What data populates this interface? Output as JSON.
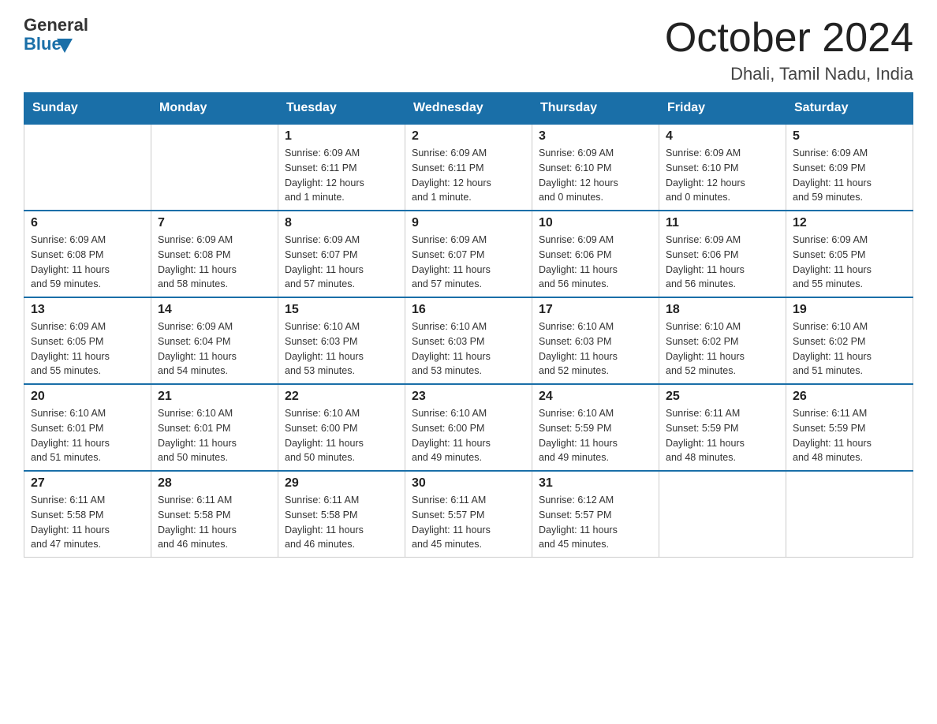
{
  "header": {
    "logo_general": "General",
    "logo_blue": "Blue",
    "title": "October 2024",
    "subtitle": "Dhali, Tamil Nadu, India"
  },
  "days_of_week": [
    "Sunday",
    "Monday",
    "Tuesday",
    "Wednesday",
    "Thursday",
    "Friday",
    "Saturday"
  ],
  "weeks": [
    [
      {
        "day": "",
        "info": ""
      },
      {
        "day": "",
        "info": ""
      },
      {
        "day": "1",
        "info": "Sunrise: 6:09 AM\nSunset: 6:11 PM\nDaylight: 12 hours\nand 1 minute."
      },
      {
        "day": "2",
        "info": "Sunrise: 6:09 AM\nSunset: 6:11 PM\nDaylight: 12 hours\nand 1 minute."
      },
      {
        "day": "3",
        "info": "Sunrise: 6:09 AM\nSunset: 6:10 PM\nDaylight: 12 hours\nand 0 minutes."
      },
      {
        "day": "4",
        "info": "Sunrise: 6:09 AM\nSunset: 6:10 PM\nDaylight: 12 hours\nand 0 minutes."
      },
      {
        "day": "5",
        "info": "Sunrise: 6:09 AM\nSunset: 6:09 PM\nDaylight: 11 hours\nand 59 minutes."
      }
    ],
    [
      {
        "day": "6",
        "info": "Sunrise: 6:09 AM\nSunset: 6:08 PM\nDaylight: 11 hours\nand 59 minutes."
      },
      {
        "day": "7",
        "info": "Sunrise: 6:09 AM\nSunset: 6:08 PM\nDaylight: 11 hours\nand 58 minutes."
      },
      {
        "day": "8",
        "info": "Sunrise: 6:09 AM\nSunset: 6:07 PM\nDaylight: 11 hours\nand 57 minutes."
      },
      {
        "day": "9",
        "info": "Sunrise: 6:09 AM\nSunset: 6:07 PM\nDaylight: 11 hours\nand 57 minutes."
      },
      {
        "day": "10",
        "info": "Sunrise: 6:09 AM\nSunset: 6:06 PM\nDaylight: 11 hours\nand 56 minutes."
      },
      {
        "day": "11",
        "info": "Sunrise: 6:09 AM\nSunset: 6:06 PM\nDaylight: 11 hours\nand 56 minutes."
      },
      {
        "day": "12",
        "info": "Sunrise: 6:09 AM\nSunset: 6:05 PM\nDaylight: 11 hours\nand 55 minutes."
      }
    ],
    [
      {
        "day": "13",
        "info": "Sunrise: 6:09 AM\nSunset: 6:05 PM\nDaylight: 11 hours\nand 55 minutes."
      },
      {
        "day": "14",
        "info": "Sunrise: 6:09 AM\nSunset: 6:04 PM\nDaylight: 11 hours\nand 54 minutes."
      },
      {
        "day": "15",
        "info": "Sunrise: 6:10 AM\nSunset: 6:03 PM\nDaylight: 11 hours\nand 53 minutes."
      },
      {
        "day": "16",
        "info": "Sunrise: 6:10 AM\nSunset: 6:03 PM\nDaylight: 11 hours\nand 53 minutes."
      },
      {
        "day": "17",
        "info": "Sunrise: 6:10 AM\nSunset: 6:03 PM\nDaylight: 11 hours\nand 52 minutes."
      },
      {
        "day": "18",
        "info": "Sunrise: 6:10 AM\nSunset: 6:02 PM\nDaylight: 11 hours\nand 52 minutes."
      },
      {
        "day": "19",
        "info": "Sunrise: 6:10 AM\nSunset: 6:02 PM\nDaylight: 11 hours\nand 51 minutes."
      }
    ],
    [
      {
        "day": "20",
        "info": "Sunrise: 6:10 AM\nSunset: 6:01 PM\nDaylight: 11 hours\nand 51 minutes."
      },
      {
        "day": "21",
        "info": "Sunrise: 6:10 AM\nSunset: 6:01 PM\nDaylight: 11 hours\nand 50 minutes."
      },
      {
        "day": "22",
        "info": "Sunrise: 6:10 AM\nSunset: 6:00 PM\nDaylight: 11 hours\nand 50 minutes."
      },
      {
        "day": "23",
        "info": "Sunrise: 6:10 AM\nSunset: 6:00 PM\nDaylight: 11 hours\nand 49 minutes."
      },
      {
        "day": "24",
        "info": "Sunrise: 6:10 AM\nSunset: 5:59 PM\nDaylight: 11 hours\nand 49 minutes."
      },
      {
        "day": "25",
        "info": "Sunrise: 6:11 AM\nSunset: 5:59 PM\nDaylight: 11 hours\nand 48 minutes."
      },
      {
        "day": "26",
        "info": "Sunrise: 6:11 AM\nSunset: 5:59 PM\nDaylight: 11 hours\nand 48 minutes."
      }
    ],
    [
      {
        "day": "27",
        "info": "Sunrise: 6:11 AM\nSunset: 5:58 PM\nDaylight: 11 hours\nand 47 minutes."
      },
      {
        "day": "28",
        "info": "Sunrise: 6:11 AM\nSunset: 5:58 PM\nDaylight: 11 hours\nand 46 minutes."
      },
      {
        "day": "29",
        "info": "Sunrise: 6:11 AM\nSunset: 5:58 PM\nDaylight: 11 hours\nand 46 minutes."
      },
      {
        "day": "30",
        "info": "Sunrise: 6:11 AM\nSunset: 5:57 PM\nDaylight: 11 hours\nand 45 minutes."
      },
      {
        "day": "31",
        "info": "Sunrise: 6:12 AM\nSunset: 5:57 PM\nDaylight: 11 hours\nand 45 minutes."
      },
      {
        "day": "",
        "info": ""
      },
      {
        "day": "",
        "info": ""
      }
    ]
  ]
}
